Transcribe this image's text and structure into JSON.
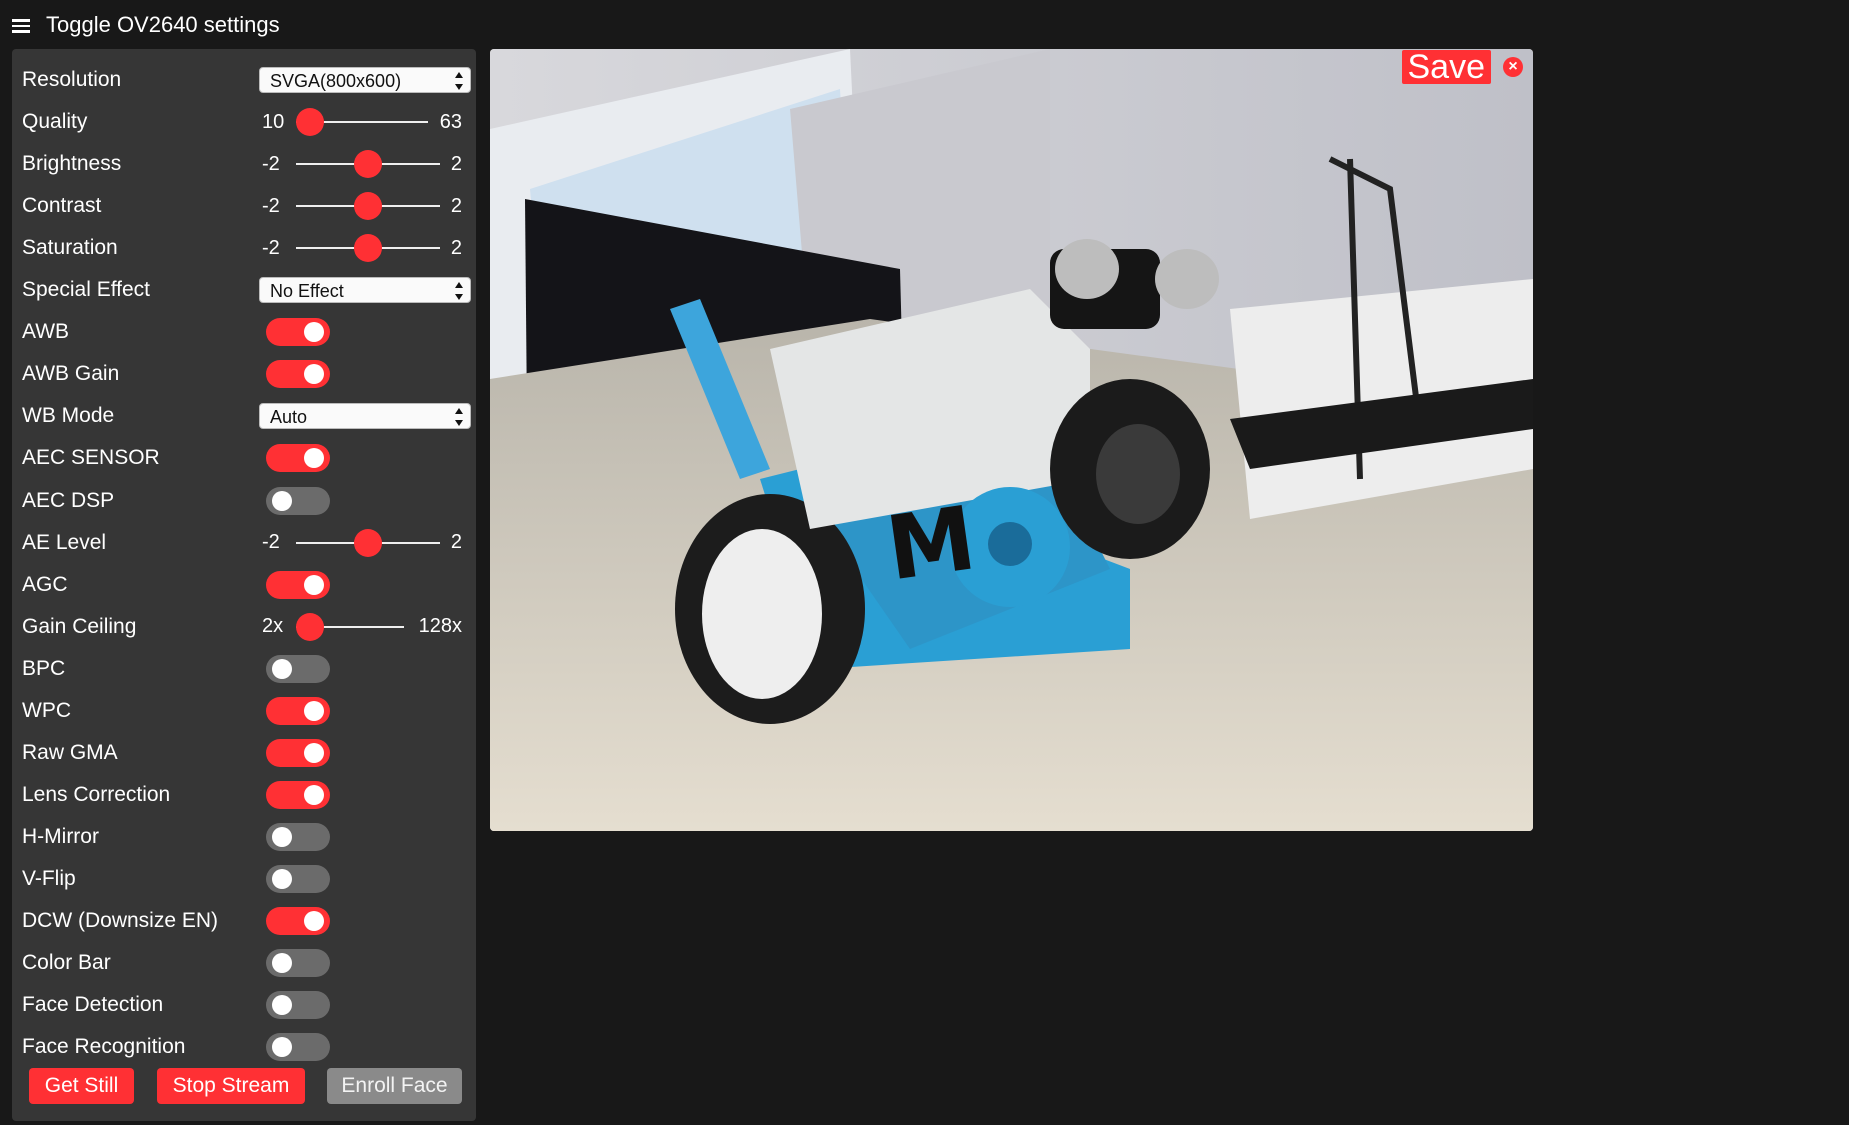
{
  "header": {
    "title": "Toggle OV2640 settings"
  },
  "settings": [
    {
      "label": "Resolution",
      "type": "select",
      "value": "SVGA(800x600)"
    },
    {
      "label": "Quality",
      "type": "slider",
      "min": "10",
      "max": "63",
      "value_fraction": 0.0
    },
    {
      "label": "Brightness",
      "type": "slider",
      "min": "-2",
      "max": "2",
      "value_fraction": 0.5
    },
    {
      "label": "Contrast",
      "type": "slider",
      "min": "-2",
      "max": "2",
      "value_fraction": 0.5
    },
    {
      "label": "Saturation",
      "type": "slider",
      "min": "-2",
      "max": "2",
      "value_fraction": 0.5
    },
    {
      "label": "Special Effect",
      "type": "select",
      "value": "No Effect"
    },
    {
      "label": "AWB",
      "type": "toggle",
      "on": true
    },
    {
      "label": "AWB Gain",
      "type": "toggle",
      "on": true
    },
    {
      "label": "WB Mode",
      "type": "select",
      "value": "Auto"
    },
    {
      "label": "AEC SENSOR",
      "type": "toggle",
      "on": true
    },
    {
      "label": "AEC DSP",
      "type": "toggle",
      "on": false
    },
    {
      "label": "AE Level",
      "type": "slider",
      "min": "-2",
      "max": "2",
      "value_fraction": 0.5
    },
    {
      "label": "AGC",
      "type": "toggle",
      "on": true
    },
    {
      "label": "Gain Ceiling",
      "type": "slider",
      "min": "2x",
      "max": "128x",
      "value_fraction": 0.0
    },
    {
      "label": "BPC",
      "type": "toggle",
      "on": false
    },
    {
      "label": "WPC",
      "type": "toggle",
      "on": true
    },
    {
      "label": "Raw GMA",
      "type": "toggle",
      "on": true
    },
    {
      "label": "Lens Correction",
      "type": "toggle",
      "on": true
    },
    {
      "label": "H-Mirror",
      "type": "toggle",
      "on": false
    },
    {
      "label": "V-Flip",
      "type": "toggle",
      "on": false
    },
    {
      "label": "DCW (Downsize EN)",
      "type": "toggle",
      "on": true
    },
    {
      "label": "Color Bar",
      "type": "toggle",
      "on": false
    },
    {
      "label": "Face Detection",
      "type": "toggle",
      "on": false
    },
    {
      "label": "Face Recognition",
      "type": "toggle",
      "on": false
    }
  ],
  "buttons": {
    "get_still": "Get Still",
    "stop_stream": "Stop Stream",
    "enroll_face": "Enroll Face"
  },
  "stream": {
    "save_label": "Save",
    "close_symbol": "×"
  },
  "colors": {
    "accent": "#ff3034",
    "panel": "#363636",
    "background": "#181818"
  }
}
